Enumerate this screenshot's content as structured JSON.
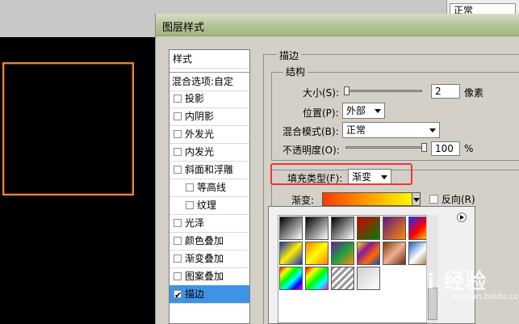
{
  "background_app": {
    "blend_mode_value": "正常"
  },
  "dialog": {
    "title": "图层样式"
  },
  "styles_list": {
    "header": "样式",
    "blend_options": "混合选项:自定",
    "items": [
      {
        "label": "投影",
        "checked": false,
        "indent": false
      },
      {
        "label": "内阴影",
        "checked": false,
        "indent": false
      },
      {
        "label": "外发光",
        "checked": false,
        "indent": false
      },
      {
        "label": "内发光",
        "checked": false,
        "indent": false
      },
      {
        "label": "斜面和浮雕",
        "checked": false,
        "indent": false
      },
      {
        "label": "等高线",
        "checked": false,
        "indent": true
      },
      {
        "label": "纹理",
        "checked": false,
        "indent": true
      },
      {
        "label": "光泽",
        "checked": false,
        "indent": false
      },
      {
        "label": "颜色叠加",
        "checked": false,
        "indent": false
      },
      {
        "label": "渐变叠加",
        "checked": false,
        "indent": false
      },
      {
        "label": "图案叠加",
        "checked": false,
        "indent": false
      },
      {
        "label": "描边",
        "checked": true,
        "indent": false,
        "selected": true
      }
    ]
  },
  "stroke": {
    "section_title": "描边",
    "structure_title": "结构",
    "size_label": "大小(S):",
    "size_value": "2",
    "size_unit": "像素",
    "size_slider_fraction": 0.0,
    "position_label": "位置(P):",
    "position_value": "外部",
    "blend_mode_label": "混合模式(B):",
    "blend_mode_value": "正常",
    "opacity_label": "不透明度(O):",
    "opacity_value": "100",
    "opacity_unit": "%",
    "opacity_slider_fraction": 1.0,
    "fill_type_label": "填充类型(F):",
    "fill_type_value": "渐变",
    "gradient_label": "渐变:",
    "reverse_label": "反向(R)",
    "reverse_checked": false
  },
  "gradient_picker": {
    "swatches": [
      {
        "name": "foreground-to-background",
        "css": "linear-gradient(135deg,#000,#fff)"
      },
      {
        "name": "foreground-to-transparent",
        "css": "linear-gradient(135deg,#000 0%,rgba(0,0,0,0) 100%)"
      },
      {
        "name": "black-white",
        "css": "linear-gradient(135deg,#000,#fff)"
      },
      {
        "name": "red-green",
        "css": "linear-gradient(135deg,#d00000,#008000)"
      },
      {
        "name": "violet-orange",
        "css": "linear-gradient(135deg,#5a1a8a,#ff8a00)"
      },
      {
        "name": "blue-red-yellow",
        "css": "linear-gradient(135deg,#1a2aff,#ff0000 50%,#ffff00)"
      },
      {
        "name": "blue-yellow-blue",
        "css": "linear-gradient(135deg,#1030c0,#ffee00 50%,#1030c0)"
      },
      {
        "name": "orange-yellow-orange",
        "css": "linear-gradient(135deg,#ff7a00,#ffff00 50%,#ff7a00)"
      },
      {
        "name": "violet-green-orange",
        "css": "linear-gradient(135deg,#6a1a9a,#20a040 50%,#ff8c00)"
      },
      {
        "name": "yellow-violet-orange-blue",
        "css": "linear-gradient(135deg,#ffdd00,#8a1a9a 33%,#ff6a00 66%,#1a40c0)"
      },
      {
        "name": "copper",
        "css": "linear-gradient(135deg,#7a3a10,#f0b090 50%,#6a2a10)"
      },
      {
        "name": "chrome",
        "css": "linear-gradient(135deg,#2060c0,#ffffff 50%,#8a5a20)"
      },
      {
        "name": "spectrum",
        "css": "linear-gradient(135deg,#ff0000,#ffff00 20%,#00ff00 40%,#00ffff 60%,#0000ff 80%,#ff00ff)"
      },
      {
        "name": "transparent-rainbow",
        "css": "linear-gradient(135deg,#ff0000,#ffff00 25%,#00ff00 50%,#00ffff 75%,#ff00ff)"
      },
      {
        "name": "transparent-stripes",
        "css": "repeating-linear-gradient(135deg,#999 0 3px,#fff 3px 6px)"
      },
      {
        "name": "neutral-density",
        "css": "linear-gradient(135deg,#cfcfcf,#ffffff)"
      }
    ]
  },
  "watermark": {
    "text": "Bai 经验",
    "sub": "jingyan.baidu.com"
  }
}
